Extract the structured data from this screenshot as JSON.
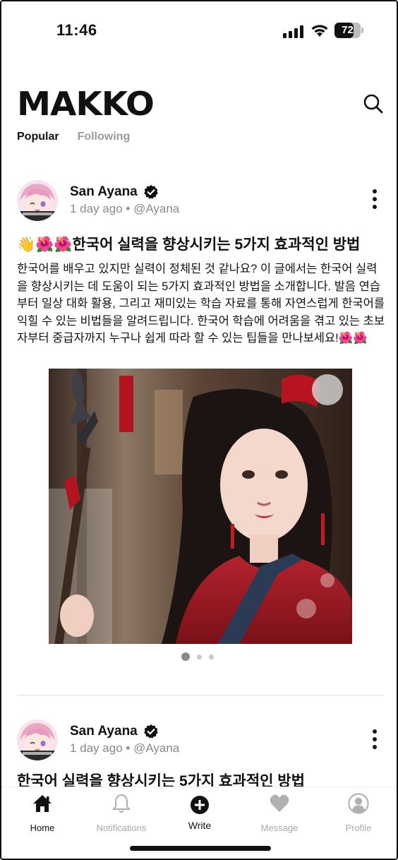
{
  "status_bar": {
    "time": "11:46",
    "battery": "72",
    "battery_level": 0.72
  },
  "header": {
    "logo": "MAKKO",
    "search_icon": "search-icon"
  },
  "tabs": [
    {
      "label": "Popular",
      "active": true
    },
    {
      "label": "Following",
      "active": false
    }
  ],
  "posts": [
    {
      "author": "San Ayana",
      "meta": "1 day ago • @Ayana",
      "title": "👋🌺🌺한국어 실력을 향상시키는 5가지 효과적인 방법",
      "body": "한국어를 배우고 있지만 실력이 정체된 것 같나요? 이 글에서는 한국어 실력을 향상시키는 데 도움이 되는 5가지 효과적인 방법을 소개합니다. 발음 연습부터 일상 대화 활용, 그리고 재미있는 학습 자료를 통해 자연스럽게 한국어를 익힐 수 있는 비법들을 알려드립니다. 한국어 학습에 어려움을 겪고 있는 초보자부터 중급자까지 누구나 쉽게 따라 할 수 있는 팁들을 만나보세요!🌺🌺",
      "carousel": {
        "count": 3,
        "active_index": 0
      }
    },
    {
      "author": "San Ayana",
      "meta": "1 day ago • @Ayana",
      "title": "한국어 실력을 향상시키는 5가지 효과적인 방법"
    }
  ],
  "bottom_nav": [
    {
      "label": "Home",
      "icon": "home-icon",
      "active": true
    },
    {
      "label": "Notifications",
      "icon": "bell-icon",
      "active": false
    },
    {
      "label": "Write",
      "icon": "plus-circle-icon",
      "active": false
    },
    {
      "label": "Message",
      "icon": "heart-icon",
      "active": false
    },
    {
      "label": "Profile",
      "icon": "profile-icon",
      "active": false
    }
  ]
}
